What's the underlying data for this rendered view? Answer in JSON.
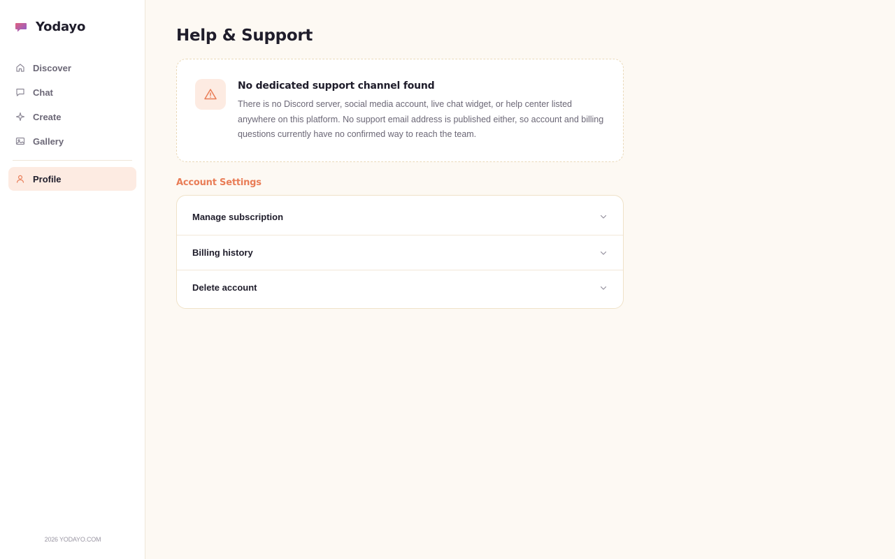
{
  "app": {
    "name": "Yodayo",
    "logo_icon": "speech-bubble-logo-icon"
  },
  "sidebar": {
    "items": [
      {
        "label": "Discover",
        "icon": "home-icon"
      },
      {
        "label": "Chat",
        "icon": "chat-icon"
      },
      {
        "label": "Create",
        "icon": "sparkle-icon"
      },
      {
        "label": "Gallery",
        "icon": "image-icon"
      }
    ],
    "active_item": {
      "label": "Profile",
      "icon": "user-icon"
    },
    "footer": "2026 YODAYO.COM"
  },
  "page": {
    "title": "Help & Support"
  },
  "notice": {
    "icon": "warning-icon",
    "title": "No dedicated support channel found",
    "body": "There is no Discord server, social media account, live chat widget, or help center listed anywhere on this platform. No support email address is published either, so account and billing questions currently have no confirmed way to reach the team."
  },
  "account_settings": {
    "heading": "Account Settings",
    "items": [
      {
        "label": "Manage subscription"
      },
      {
        "label": "Billing history"
      },
      {
        "label": "Delete account"
      }
    ]
  },
  "colors": {
    "accent": "#e97d57",
    "active_bg": "#fdebe2",
    "page_bg": "#fdf9f3",
    "text_primary": "#1f1d2b",
    "text_muted": "#6b6776"
  }
}
